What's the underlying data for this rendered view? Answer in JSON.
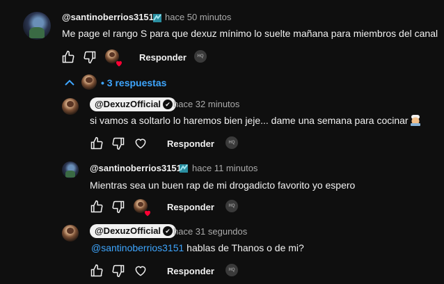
{
  "comments": [
    {
      "username": "@santinoberrios3151",
      "time": "hace 50 minutos",
      "text": "Me page el rango S para que dexuz mínimo lo suelte mañana para miembros del canal",
      "reply_label": "Responder"
    },
    {
      "username": "@DexuzOfficial",
      "time": "hace 32 minutos",
      "text": "si vamos a soltarlo lo haremos bien jeje... dame una semana para cocinar",
      "reply_label": "Responder"
    },
    {
      "username": "@santinoberrios3151",
      "time": "hace 11 minutos",
      "text": "Mientras sea un buen rap de mi drogadicto favorito yo espero",
      "reply_label": "Responder"
    },
    {
      "username": "@DexuzOfficial",
      "time": "hace 31 segundos",
      "mention": "@santinoberrios3151",
      "text": " hablas de Thanos o de mi?",
      "reply_label": "Responder"
    }
  ],
  "replies_toggle": {
    "dot": "•",
    "label": "3 respuestas"
  },
  "icons": {
    "like": "thumbs-up-icon",
    "dislike": "thumbs-down-icon",
    "heart": "heart-icon",
    "creator_heart": "creator-heart-icon",
    "verified": "verified-check-icon",
    "member": "member-badge-icon",
    "chevron": "chevron-up-icon"
  },
  "colors": {
    "background": "#0f0f0f",
    "text": "#f1f1f1",
    "secondary": "#aaaaaa",
    "link": "#3ea6ff",
    "heart": "#ff0033"
  }
}
